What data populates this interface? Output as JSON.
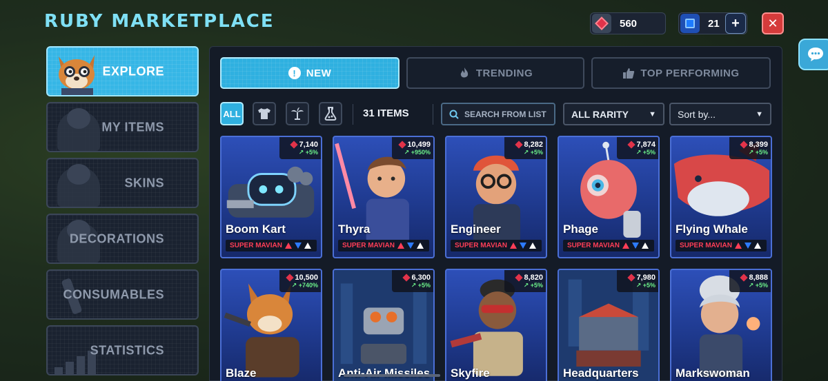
{
  "title": "RUBY MARKETPLACE",
  "currencies": {
    "rubies": "560",
    "gems": "21"
  },
  "sidebar": {
    "items": [
      {
        "label": "EXPLORE"
      },
      {
        "label": "MY ITEMS"
      },
      {
        "label": "SKINS"
      },
      {
        "label": "DECORATIONS"
      },
      {
        "label": "CONSUMABLES"
      },
      {
        "label": "STATISTICS"
      }
    ]
  },
  "tabs": [
    {
      "label": "NEW"
    },
    {
      "label": "TRENDING"
    },
    {
      "label": "TOP PERFORMING"
    }
  ],
  "filters": {
    "all_label": "ALL",
    "item_count": "31 ITEMS",
    "search_placeholder": "SEARCH FROM LIST",
    "rarity": "ALL RARITY",
    "sort": "Sort by..."
  },
  "items": [
    {
      "name": "Boom Kart",
      "price": "7,140",
      "change": "↗ +5%",
      "rarity": "SUPER MAVIAN"
    },
    {
      "name": "Thyra",
      "price": "10,499",
      "change": "↗ +950%",
      "rarity": "SUPER MAVIAN"
    },
    {
      "name": "Engineer",
      "price": "8,282",
      "change": "↗ +5%",
      "rarity": "SUPER MAVIAN"
    },
    {
      "name": "Phage",
      "price": "7,874",
      "change": "↗ +5%",
      "rarity": "SUPER MAVIAN"
    },
    {
      "name": "Flying Whale",
      "price": "8,399",
      "change": "↗ +5%",
      "rarity": "SUPER MAVIAN"
    },
    {
      "name": "Blaze",
      "price": "10,500",
      "change": "↗ +740%"
    },
    {
      "name": "Anti-Air Missiles",
      "price": "6,300",
      "change": "↗ +5%"
    },
    {
      "name": "Skyfire",
      "price": "8,820",
      "change": "↗ +5%"
    },
    {
      "name": "Headquarters",
      "price": "7,980",
      "change": "↗ +5%"
    },
    {
      "name": "Markswoman",
      "price": "8,888",
      "change": "↗ +5%"
    }
  ],
  "colors": {
    "accent": "#2fb0e0",
    "ruby": "#e2334a",
    "rarity": "#ff3e57",
    "gain": "#6cf28a"
  }
}
